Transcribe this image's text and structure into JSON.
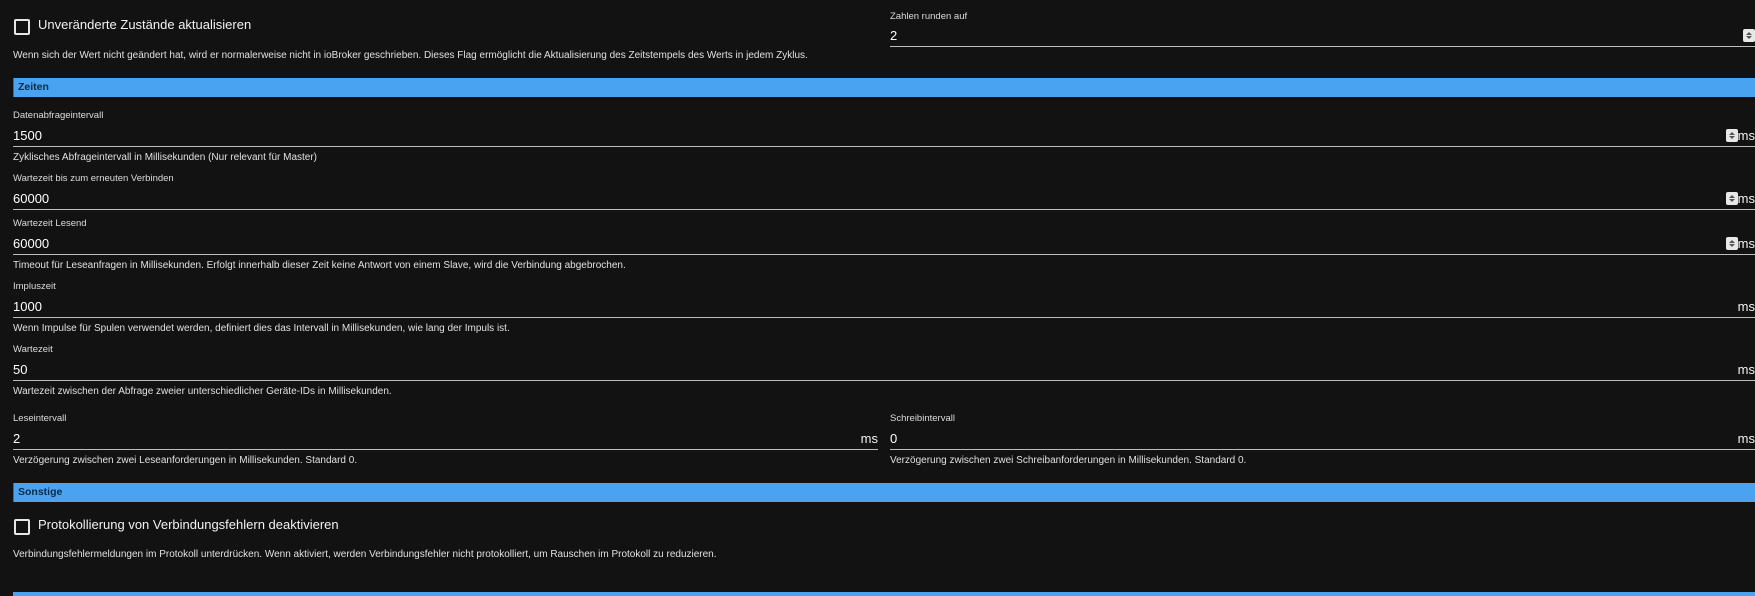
{
  "general": {
    "update_unchanged_label": "Unveränderte Zustände aktualisieren",
    "update_unchanged_help": "Wenn sich der Wert nicht geändert hat, wird er normalerweise nicht in ioBroker geschrieben. Dieses Flag ermöglicht die Aktualisierung des Zeitstempels des Werts in jedem Zyklus.",
    "update_unchanged_checked": false,
    "round_label": "Zahlen runden auf",
    "round_value": "2"
  },
  "sections": {
    "times": "Zeiten",
    "other": "Sonstige"
  },
  "times": {
    "poll_interval": {
      "label": "Datenabfrageintervall",
      "value": "1500",
      "unit": "ms",
      "help": "Zyklisches Abfrageintervall in Millisekunden (Nur relevant für Master)"
    },
    "reconnect_timeout": {
      "label": "Wartezeit bis zum erneuten Verbinden",
      "value": "60000",
      "unit": "ms"
    },
    "read_timeout": {
      "label": "Wartezeit Lesend",
      "value": "60000",
      "unit": "ms",
      "help": "Timeout für Leseanfragen in Millisekunden. Erfolgt innerhalb dieser Zeit keine Antwort von einem Slave, wird die Verbindung abgebrochen."
    },
    "pulse_time": {
      "label": "Impluszeit",
      "value": "1000",
      "unit": "ms",
      "help": "Wenn Impulse für Spulen verwendet werden, definiert dies das Intervall in Millisekunden, wie lang der Impuls ist."
    },
    "wait_time": {
      "label": "Wartezeit",
      "value": "50",
      "unit": "ms",
      "help": "Wartezeit zwischen der Abfrage zweier unterschiedlicher Geräte-IDs in Millisekunden."
    },
    "read_interval": {
      "label": "Leseintervall",
      "value": "2",
      "unit": "ms",
      "help": "Verzögerung zwischen zwei Leseanforderungen in Millisekunden. Standard 0."
    },
    "write_interval": {
      "label": "Schreibintervall",
      "value": "0",
      "unit": "ms",
      "help": "Verzögerung zwischen zwei Schreibanforderungen in Millisekunden. Standard 0."
    }
  },
  "other": {
    "disable_conn_errors_label": "Protokollierung von Verbindungsfehlern deaktivieren",
    "disable_conn_errors_help": "Verbindungsfehlermeldungen im Protokoll unterdrücken. Wenn aktiviert, werden Verbindungsfehler nicht protokolliert, um Rauschen im Protokoll zu reduzieren.",
    "disable_conn_errors_checked": false
  },
  "colors": {
    "background": "#121212",
    "section_bar": "#4aa3f0",
    "text": "#ffffff"
  }
}
